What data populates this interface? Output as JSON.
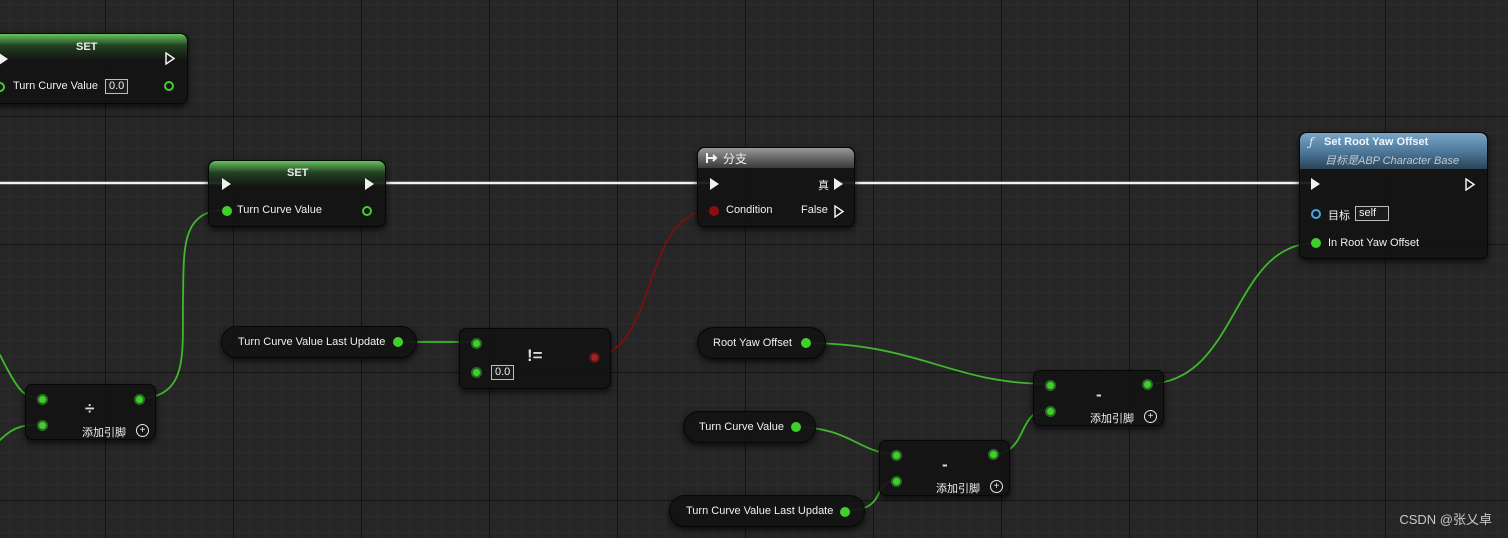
{
  "node_set_top": {
    "title": "SET",
    "var_label": "Turn Curve Value",
    "value": "0.0"
  },
  "node_set_main": {
    "title": "SET",
    "var_label": "Turn Curve Value"
  },
  "node_branch": {
    "title": "分支",
    "true_label": "真",
    "condition_label": "Condition",
    "false_label": "False"
  },
  "node_set_root_yaw": {
    "title": "Set Root Yaw Offset",
    "subtitle": "目标是ABP Character Base",
    "target_label": "目标",
    "target_value": "self",
    "input_label": "In Root Yaw Offset"
  },
  "node_divide": {
    "op": "÷",
    "add_pin_label": "添加引脚"
  },
  "node_not_equal": {
    "op": "!=",
    "value": "0.0"
  },
  "node_subtract_1": {
    "op": "-",
    "add_pin_label": "添加引脚"
  },
  "node_subtract_2": {
    "op": "-",
    "add_pin_label": "添加引脚"
  },
  "getters": {
    "turn_curve_last_update_1": "Turn Curve Value Last Update",
    "root_yaw_offset": "Root Yaw Offset",
    "turn_curve_value": "Turn Curve Value",
    "turn_curve_last_update_2": "Turn Curve Value Last Update"
  },
  "icons": {
    "function": "function-icon",
    "branch": "branch-icon",
    "add_pin": "plus-circle-icon"
  },
  "colors": {
    "exec_wire": "#f2f2f2",
    "float_wire": "#3fb82c",
    "bool_wire": "#7a1010",
    "object_pin": "#43a7e8"
  },
  "watermark": "CSDN @张乂卓"
}
